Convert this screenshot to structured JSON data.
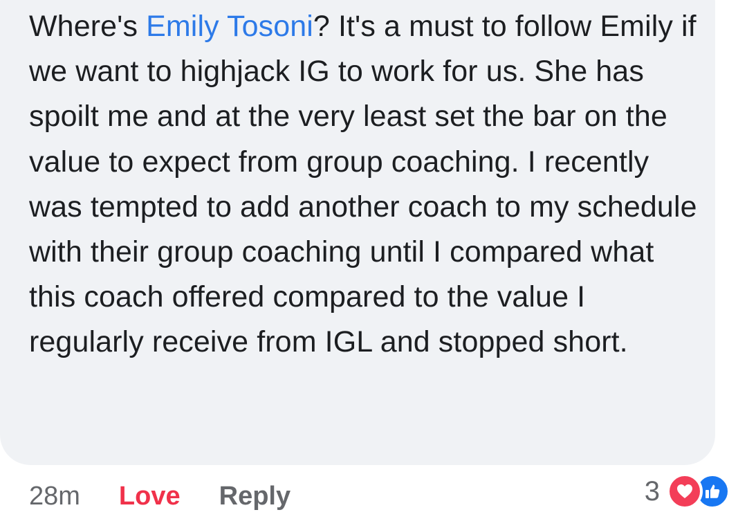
{
  "comment": {
    "text_before_mention": "Where's ",
    "mention": "Emily Tosoni",
    "text_after_mention": "? It's a must to follow Emily if we want to highjack IG to work for us. She has spoilt me and at the very least set the bar on the value to expect from group coaching. I recently was tempted to add another coach to my schedule with their group coaching until I compared what this coach offered compared to the value I regularly receive from IGL and stopped short."
  },
  "actions": {
    "timestamp": "28m",
    "love_label": "Love",
    "reply_label": "Reply"
  },
  "reactions": {
    "count": "3",
    "icons": [
      "heart-icon",
      "thumbs-up-icon"
    ],
    "love_color": "#f33e58",
    "like_color": "#1877f2"
  },
  "colors": {
    "mention": "#2d7ae8",
    "love_action": "#f0314a",
    "bubble_bg": "#f0f2f5",
    "muted_text": "#65676b"
  }
}
